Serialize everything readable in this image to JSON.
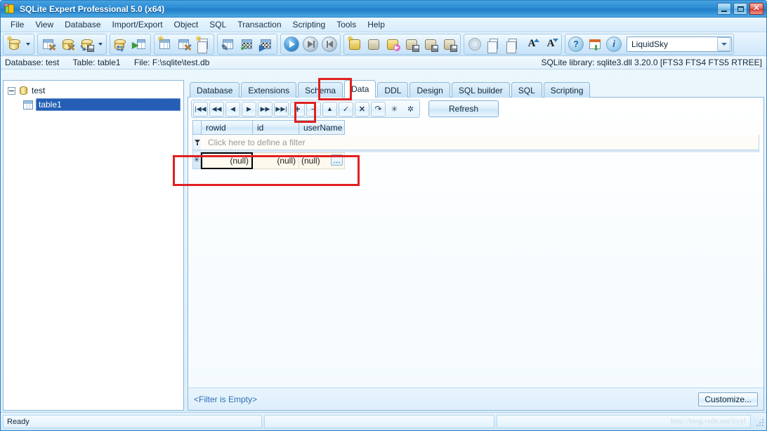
{
  "window": {
    "title": "SQLite Expert Professional 5.0 (x64)",
    "app_icon": "sqlite-expert-icon",
    "buttons": {
      "minimize": "minimize",
      "maximize": "maximize",
      "close": "close"
    }
  },
  "menu": {
    "items": [
      {
        "label": "File"
      },
      {
        "label": "View"
      },
      {
        "label": "Database"
      },
      {
        "label": "Import/Export"
      },
      {
        "label": "Object"
      },
      {
        "label": "SQL"
      },
      {
        "label": "Transaction"
      },
      {
        "label": "Scripting"
      },
      {
        "label": "Tools"
      },
      {
        "label": "Help"
      }
    ]
  },
  "toolbar": {
    "groups": [
      {
        "buttons": [
          {
            "icon": "new-database-icon",
            "name": "new-database"
          }
        ],
        "dropdown": true
      },
      {
        "buttons": [
          {
            "icon": "design-database-icon",
            "name": "design-database"
          },
          {
            "icon": "maintain-database-icon",
            "name": "maintain-database"
          },
          {
            "icon": "backup-database-icon",
            "name": "backup-database"
          }
        ],
        "dropdown": true
      },
      {
        "buttons": [
          {
            "icon": "transfer-data-icon",
            "name": "transfer-data"
          },
          {
            "icon": "import-table-icon",
            "name": "import-table"
          }
        ],
        "dropdown": false
      },
      {
        "buttons": [
          {
            "icon": "new-table-icon",
            "name": "new-table"
          },
          {
            "icon": "design-table-icon",
            "name": "design-table"
          },
          {
            "icon": "new-view-icon",
            "name": "new-view"
          }
        ],
        "dropdown": false
      },
      {
        "buttons": [
          {
            "icon": "edit-data-icon",
            "name": "edit-data"
          },
          {
            "icon": "apply-changes-icon",
            "name": "apply-changes"
          },
          {
            "icon": "run-data-icon",
            "name": "run-data"
          }
        ],
        "dropdown": false
      },
      {
        "buttons": [
          {
            "icon": "play-icon",
            "name": "execute-sql"
          },
          {
            "icon": "step-icon",
            "name": "execute-step"
          },
          {
            "icon": "stop-icon",
            "name": "stop-execution"
          }
        ],
        "dropdown": false
      },
      {
        "buttons": [
          {
            "icon": "new-script-icon",
            "name": "new-script"
          },
          {
            "icon": "open-script-icon",
            "name": "open-script"
          },
          {
            "icon": "run-script-icon",
            "name": "run-script"
          },
          {
            "icon": "save-script-icon",
            "name": "save-script"
          },
          {
            "icon": "save-script-as-icon",
            "name": "save-script-as"
          },
          {
            "icon": "save-all-scripts-icon",
            "name": "save-all-scripts"
          }
        ],
        "dropdown": false
      },
      {
        "buttons": [
          {
            "icon": "options-gear-icon",
            "name": "options"
          },
          {
            "icon": "copy-icon",
            "name": "copy"
          },
          {
            "icon": "paste-icon",
            "name": "paste"
          },
          {
            "icon": "font-increase-icon",
            "name": "font-increase"
          },
          {
            "icon": "font-decrease-icon",
            "name": "font-decrease"
          }
        ],
        "dropdown": false
      },
      {
        "buttons": [
          {
            "icon": "help-icon",
            "name": "help"
          },
          {
            "icon": "check-updates-icon",
            "name": "check-updates"
          },
          {
            "icon": "about-icon",
            "name": "about"
          }
        ],
        "dropdown": false
      }
    ],
    "theme_combo": {
      "value": "LiquidSky",
      "name": "theme-select"
    }
  },
  "infobar": {
    "database_label": "Database: test",
    "table_label": "Table: table1",
    "file_label": "File: F:\\sqlite\\test.db",
    "library_label": "SQLite library: sqlite3.dll 3.20.0 [FTS3 FTS4 FTS5 RTREE]"
  },
  "sidebar": {
    "root": {
      "label": "test",
      "icon": "database-icon",
      "expanded": true,
      "expander": "collapse"
    },
    "children": [
      {
        "label": "table1",
        "icon": "table-icon",
        "selected": true
      }
    ]
  },
  "tabs": [
    {
      "label": "Database",
      "active": false
    },
    {
      "label": "Extensions",
      "active": false
    },
    {
      "label": "Schema",
      "active": false
    },
    {
      "label": "Data",
      "active": true
    },
    {
      "label": "DDL",
      "active": false
    },
    {
      "label": "Design",
      "active": false
    },
    {
      "label": "SQL builder",
      "active": false
    },
    {
      "label": "SQL",
      "active": false
    },
    {
      "label": "Scripting",
      "active": false
    }
  ],
  "navbar": {
    "buttons": [
      {
        "name": "first-record",
        "glyph": "|◀◀",
        "title": "First"
      },
      {
        "name": "prior-page",
        "glyph": "◀◀",
        "title": "Prior page"
      },
      {
        "name": "prior-record",
        "glyph": "◀",
        "title": "Prior"
      },
      {
        "name": "next-record",
        "glyph": "▶",
        "title": "Next"
      },
      {
        "name": "next-page",
        "glyph": "▶▶",
        "title": "Next page"
      },
      {
        "name": "last-record",
        "glyph": "▶▶|",
        "title": "Last"
      },
      {
        "name": "insert-record",
        "glyph": "+",
        "title": "Insert",
        "highlighted": true
      },
      {
        "name": "delete-record",
        "glyph": "−",
        "title": "Delete"
      },
      {
        "name": "edit-record",
        "glyph": "▲",
        "title": "Edit"
      },
      {
        "name": "post-edit",
        "glyph": "✓",
        "title": "Post"
      },
      {
        "name": "cancel-edit",
        "glyph": "✕",
        "title": "Cancel"
      },
      {
        "name": "refresh-record",
        "glyph": "↷",
        "title": "Refresh record"
      },
      {
        "name": "set-null",
        "glyph": "✳",
        "title": "Set to NULL"
      },
      {
        "name": "set-default",
        "glyph": "✲",
        "title": "Set default"
      }
    ],
    "refresh_label": "Refresh"
  },
  "grid": {
    "columns": [
      {
        "label": "rowid"
      },
      {
        "label": "id"
      },
      {
        "label": "userName"
      }
    ],
    "filter_row_placeholder": "Click here to define a filter",
    "rows": [
      {
        "indicator": "✳",
        "cells": [
          "(null)",
          "(null)",
          "(null)"
        ],
        "focused_cell": 0,
        "ellipsis_button": "…"
      }
    ]
  },
  "panel_footer": {
    "filter_status": "<Filter is Empty>",
    "customize_label": "Customize..."
  },
  "statusbar": {
    "ready": "Ready",
    "middle": "",
    "watermark": "http://blog.csdn.net/liyyf"
  },
  "annotations": [
    {
      "name": "data-tab-highlight"
    },
    {
      "name": "insert-button-highlight"
    },
    {
      "name": "new-row-highlight"
    }
  ],
  "colors": {
    "accent": "#2b8bd4",
    "annotation": "#e02020",
    "selection": "#245fb5",
    "cell_bg": "#fdf9ec"
  }
}
